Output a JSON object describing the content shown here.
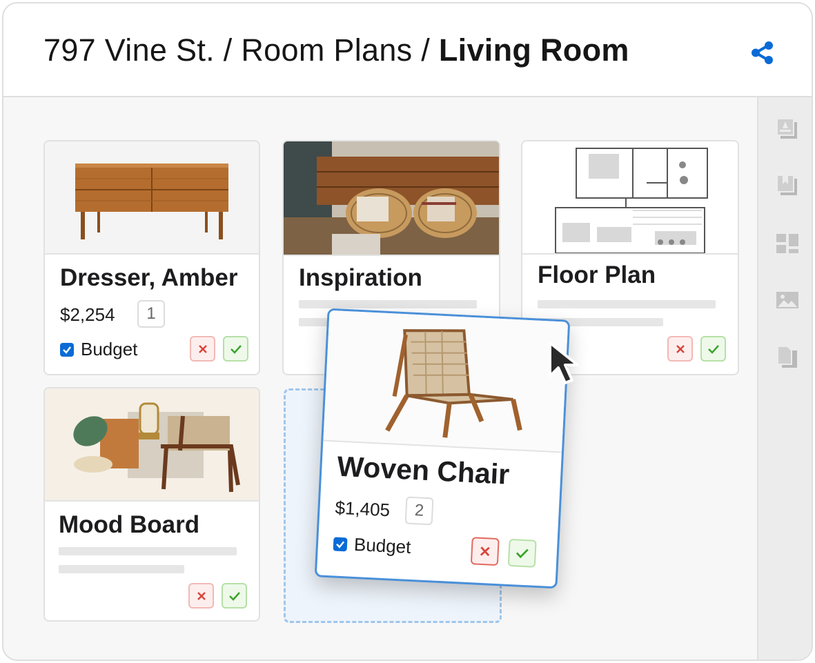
{
  "header": {
    "breadcrumb_prefix": "797 Vine St. / Room Plans / ",
    "breadcrumb_current": "Living Room"
  },
  "toolbar": {
    "share_icon": "share-icon"
  },
  "rail": {
    "icons": [
      "lamp-layers-icon",
      "bookmark-layers-icon",
      "layout-icon",
      "image-icon",
      "documents-icon"
    ]
  },
  "cards": {
    "dresser": {
      "title": "Dresser, Amber",
      "price": "$2,254",
      "quantity": "1",
      "budget_label": "Budget",
      "budget_checked": true
    },
    "inspiration": {
      "title": "Inspiration"
    },
    "floor_plan": {
      "title": "Floor Plan"
    },
    "mood_board": {
      "title": "Mood Board"
    },
    "woven_chair": {
      "title": "Woven Chair",
      "price": "$1,405",
      "quantity": "2",
      "budget_label": "Budget",
      "budget_checked": true
    }
  },
  "colors": {
    "accent": "#0a6bd6",
    "drag_border": "#4a90d9",
    "reject": "#d9453a",
    "approve": "#3aa42c"
  }
}
